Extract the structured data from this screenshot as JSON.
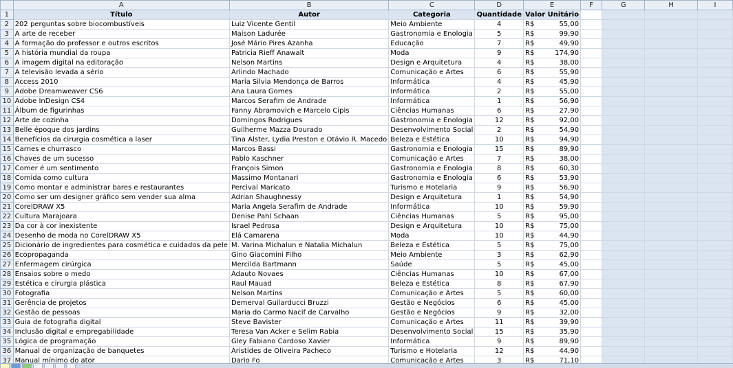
{
  "columns": [
    "A",
    "B",
    "C",
    "D",
    "E",
    "F",
    "G",
    "H",
    "I"
  ],
  "header": {
    "titulo": "Título",
    "autor": "Autor",
    "categoria": "Categoria",
    "quantidade": "Quantidade",
    "valor": "Valor Unitário"
  },
  "currency": "R$",
  "rows": [
    {
      "n": "2",
      "titulo": "202 perguntas sobre biocombustíveis",
      "autor": "Luiz Vicente Gentil",
      "categoria": "Meio Ambiente",
      "qtd": "4",
      "valor": "55,00"
    },
    {
      "n": "3",
      "titulo": "A arte de receber",
      "autor": "Maison Ladurée",
      "categoria": "Gastronomia e Enologia",
      "qtd": "5",
      "valor": "99,90"
    },
    {
      "n": "4",
      "titulo": "A formação do professor e outros escritos",
      "autor": "José Mário Pires Azanha",
      "categoria": "Educação",
      "qtd": "7",
      "valor": "49,90"
    },
    {
      "n": "5",
      "titulo": "A história mundial da roupa",
      "autor": "Patricia Rieff Anawalt",
      "categoria": "Moda",
      "qtd": "9",
      "valor": "174,90"
    },
    {
      "n": "6",
      "titulo": "A imagem digital na editoração",
      "autor": "Nelson Martins",
      "categoria": "Design e Arquitetura",
      "qtd": "4",
      "valor": "38,00"
    },
    {
      "n": "7",
      "titulo": "A televisão levada a sério",
      "autor": "Arlindo Machado",
      "categoria": "Comunicação e Artes",
      "qtd": "6",
      "valor": "55,90"
    },
    {
      "n": "8",
      "titulo": "Access 2010",
      "autor": "Maria Silvia Mendonça de Barros",
      "categoria": "Informática",
      "qtd": "4",
      "valor": "45,90"
    },
    {
      "n": "9",
      "titulo": "Adobe Dreamweaver CS6",
      "autor": "Ana Laura Gomes",
      "categoria": "Informática",
      "qtd": "2",
      "valor": "55,00"
    },
    {
      "n": "10",
      "titulo": "Adobe InDesign CS4",
      "autor": "Marcos Serafim de Andrade",
      "categoria": "Informática",
      "qtd": "1",
      "valor": "56,90"
    },
    {
      "n": "11",
      "titulo": "Álbum de figurinhas",
      "autor": "Fanny Abramovich e Marcelo Cipis",
      "categoria": "Ciências Humanas",
      "qtd": "6",
      "valor": "27,90"
    },
    {
      "n": "12",
      "titulo": "Arte de cozinha",
      "autor": "Domingos Rodrigues",
      "categoria": "Gastronomia e Enologia",
      "qtd": "12",
      "valor": "92,00"
    },
    {
      "n": "13",
      "titulo": "Belle époque dos jardins",
      "autor": "Guilherme Mazza Dourado",
      "categoria": "Desenvolvimento Social",
      "qtd": "2",
      "valor": "54,90"
    },
    {
      "n": "14",
      "titulo": "Benefícios da cirurgia cosmética a laser",
      "autor": "Tina Alster, Lydia Preston e Otávio R. Macedo",
      "categoria": "Beleza e Estética",
      "qtd": "10",
      "valor": "94,90"
    },
    {
      "n": "15",
      "titulo": "Carnes e churrasco",
      "autor": "Marcos Bassi",
      "categoria": "Gastronomia e Enologia",
      "qtd": "15",
      "valor": "89,90"
    },
    {
      "n": "16",
      "titulo": "Chaves de um sucesso",
      "autor": "Pablo Kaschner",
      "categoria": "Comunicação e Artes",
      "qtd": "7",
      "valor": "38,00"
    },
    {
      "n": "17",
      "titulo": "Comer é um sentimento",
      "autor": "François Simon",
      "categoria": "Gastronomia e Enologia",
      "qtd": "8",
      "valor": "60,30"
    },
    {
      "n": "18",
      "titulo": "Comida como cultura",
      "autor": "Massimo Montanari",
      "categoria": "Gastronomia e Enologia",
      "qtd": "6",
      "valor": "53,90"
    },
    {
      "n": "19",
      "titulo": "Como montar e administrar bares e restaurantes",
      "autor": "Percival Maricato",
      "categoria": "Turismo e Hotelaria",
      "qtd": "9",
      "valor": "56,90"
    },
    {
      "n": "20",
      "titulo": "Como ser um designer gráfico sem vender sua alma",
      "autor": "Adrian Shaughnessy",
      "categoria": "Design e Arquitetura",
      "qtd": "1",
      "valor": "54,90"
    },
    {
      "n": "21",
      "titulo": "CorelDRAW X5",
      "autor": "Maria Angela Serafim de Andrade",
      "categoria": "Informática",
      "qtd": "10",
      "valor": "59,90"
    },
    {
      "n": "22",
      "titulo": "Cultura Marajoara",
      "autor": "Denise Pahl Schaan",
      "categoria": "Ciências Humanas",
      "qtd": "5",
      "valor": "95,00"
    },
    {
      "n": "23",
      "titulo": "Da cor à cor inexistente",
      "autor": "Israel Pedrosa",
      "categoria": "Design e Arquitetura",
      "qtd": "10",
      "valor": "75,00"
    },
    {
      "n": "24",
      "titulo": "Desenho de moda no CorelDRAW X5",
      "autor": "Elá Camarena",
      "categoria": "Moda",
      "qtd": "10",
      "valor": "44,90"
    },
    {
      "n": "25",
      "titulo": "Dicionário de ingredientes para cosmética e cuidados da pele",
      "autor": "M. Varina Michalun e Natalia Michalun",
      "categoria": "Beleza e Estética",
      "qtd": "5",
      "valor": "75,00"
    },
    {
      "n": "26",
      "titulo": "Ecopropaganda",
      "autor": "Gino Giacomini Filho",
      "categoria": "Meio Ambiente",
      "qtd": "3",
      "valor": "62,90"
    },
    {
      "n": "27",
      "titulo": "Enfermagem cirúrgica",
      "autor": "Mercilda Bartmann",
      "categoria": "Saúde",
      "qtd": "5",
      "valor": "45,00"
    },
    {
      "n": "28",
      "titulo": "Ensaios sobre o medo",
      "autor": "Adauto Novaes",
      "categoria": "Ciências Humanas",
      "qtd": "10",
      "valor": "67,00"
    },
    {
      "n": "29",
      "titulo": "Estética e cirurgia plástica",
      "autor": "Raul Mauad",
      "categoria": "Beleza e Estética",
      "qtd": "8",
      "valor": "67,90"
    },
    {
      "n": "30",
      "titulo": "Fotografia",
      "autor": "Nelson Martins",
      "categoria": "Comunicação e Artes",
      "qtd": "5",
      "valor": "60,00"
    },
    {
      "n": "31",
      "titulo": "Gerência de projetos",
      "autor": "Demerval Guilarducci Bruzzi",
      "categoria": "Gestão e Negócios",
      "qtd": "6",
      "valor": "45,00"
    },
    {
      "n": "32",
      "titulo": "Gestão de pessoas",
      "autor": "Maria do Carmo Nacif de Carvalho",
      "categoria": "Gestão e Negócios",
      "qtd": "9",
      "valor": "32,00"
    },
    {
      "n": "33",
      "titulo": "Guia de fotografia digital",
      "autor": "Steve Bavister",
      "categoria": "Comunicação e Artes",
      "qtd": "11",
      "valor": "39,90"
    },
    {
      "n": "34",
      "titulo": "Inclusão digital e empregabilidade",
      "autor": "Teresa Van Acker e Selim Rabia",
      "categoria": "Desenvolvimento Social",
      "qtd": "15",
      "valor": "35,90"
    },
    {
      "n": "35",
      "titulo": "Lógica de programação",
      "autor": "Gley Fabiano Cardoso Xavier",
      "categoria": "Informática",
      "qtd": "9",
      "valor": "89,90"
    },
    {
      "n": "36",
      "titulo": "Manual de organização de banquetes",
      "autor": "Aristides de Oliveira Pacheco",
      "categoria": "Turismo e Hotelaria",
      "qtd": "12",
      "valor": "44,90"
    },
    {
      "n": "37",
      "titulo": "Manual mínimo do ator",
      "autor": "Dario Fo",
      "categoria": "Comunicação e Artes",
      "qtd": "3",
      "valor": "71,10"
    }
  ]
}
